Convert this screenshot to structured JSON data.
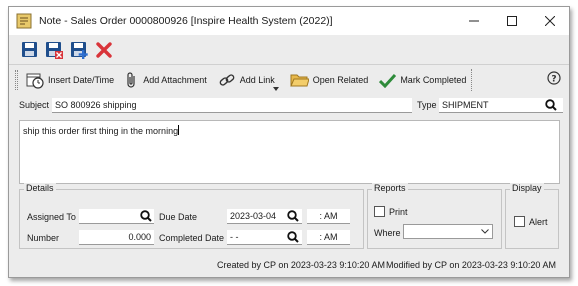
{
  "window": {
    "title": "Note - Sales Order 0000800926 [Inspire Health System (2022)]"
  },
  "toolbar2": {
    "insert_datetime": "Insert Date/Time",
    "add_attachment": "Add Attachment",
    "add_link": "Add Link",
    "open_related": "Open Related",
    "mark_completed": "Mark Completed"
  },
  "form": {
    "subject_label": "Subject",
    "subject_value": "SO 800926 shipping",
    "type_label": "Type",
    "type_value": "SHIPMENT",
    "notes": "ship this order first thing in the morning"
  },
  "details": {
    "title": "Details",
    "assigned_to_label": "Assigned To",
    "assigned_to_value": "",
    "number_label": "Number",
    "number_value": "0.000",
    "due_date_label": "Due Date",
    "due_date_value": "2023-03-04",
    "due_time_value": ":   AM",
    "completed_date_label": "Completed Date",
    "completed_date_value": "  -  -",
    "completed_time_value": ":   AM"
  },
  "reports": {
    "title": "Reports",
    "print_label": "Print",
    "where_label": "Where",
    "where_value": ""
  },
  "display": {
    "title": "Display",
    "alert_label": "Alert"
  },
  "status": {
    "created": "Created by CP on 2023-03-23 9:10:20 AM",
    "modified": "Modified by CP on 2023-03-23 9:10:20 AM"
  },
  "colors": {
    "save_blue": "#1f4e8c",
    "delete_red": "#d9343a",
    "link_green": "#2e8b3a",
    "folder_yellow": "#e8b84a"
  }
}
